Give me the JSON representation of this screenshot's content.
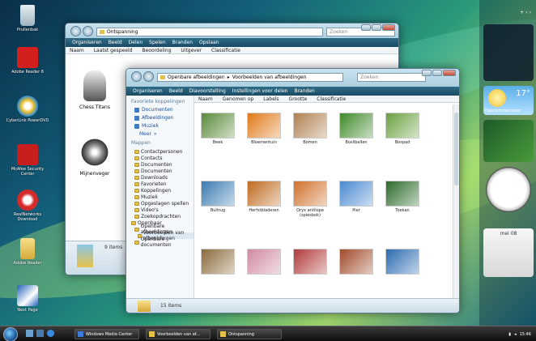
{
  "desktop": {
    "icons": [
      {
        "label": "Prullenbak"
      },
      {
        "label": "Adobe Reader 8"
      },
      {
        "label": "CyberLink PowerDVD"
      },
      {
        "label": "McAfee Security Center"
      },
      {
        "label": "RealNetworks Download"
      },
      {
        "label": "Adobe Reader"
      },
      {
        "label": "Next Page"
      }
    ]
  },
  "back_window": {
    "address": "Ontspanning",
    "search_placeholder": "Zoeken",
    "toolbar": [
      "Organiseren",
      "Beeld",
      "Delen",
      "Spelen",
      "Branden",
      "Opslaan"
    ],
    "columns": [
      "Naam",
      "Laatst gespeeld",
      "Beoordeling",
      "Uitgever",
      "Classificatie"
    ],
    "items": [
      {
        "label": "Chess Titans"
      },
      {
        "label": "Mijnenveger"
      }
    ],
    "status": "9 items"
  },
  "front_window": {
    "breadcrumb": [
      "Openbare afbeeldingen",
      "Voorbeelden van afbeeldingen"
    ],
    "search_placeholder": "Zoeken",
    "toolbar": [
      "Organiseren",
      "Beeld",
      "Diavoorstelling",
      "Instellingen voor delen",
      "Branden"
    ],
    "columns": [
      "Naam",
      "Genomen op",
      "Labels",
      "Grootte",
      "Classificatie"
    ],
    "favorites_header": "Favoriete koppelingen",
    "favorites": [
      "Documenten",
      "Afbeeldingen",
      "Muziek"
    ],
    "more": "Meer",
    "folders_header": "Mappen",
    "tree": [
      "Contactpersonen",
      "Contacts",
      "Documenten",
      "Documenten",
      "Downloads",
      "Favorieten",
      "Koppelingen",
      "Muziek",
      "Opgeslagen spellen",
      "Video's",
      "Zoekopdrachten",
      "Openbaar",
      "Openbare afbeeldingen",
      "Voorbeelden van afbeeldingen",
      "Openbare documenten"
    ],
    "thumbnails": [
      {
        "label": "Beek",
        "color": "#5a8a3a"
      },
      {
        "label": "Bloementuin",
        "color": "#e07a1a"
      },
      {
        "label": "Bomen",
        "color": "#b08050"
      },
      {
        "label": "Boslibellen",
        "color": "#3f8a2a"
      },
      {
        "label": "Bospad",
        "color": "#6aa040"
      },
      {
        "label": "Bultrug",
        "color": "#3a7ab0"
      },
      {
        "label": "Herfstbladeren",
        "color": "#c06a20"
      },
      {
        "label": "Oryx antilope (spiesbok)",
        "color": "#d0702a"
      },
      {
        "label": "Pier",
        "color": "#4a8ad0"
      },
      {
        "label": "Toekan",
        "color": "#2a6a2a"
      },
      {
        "label": "",
        "color": "#8a6a3a"
      },
      {
        "label": "",
        "color": "#d08aa0"
      },
      {
        "label": "",
        "color": "#b03a3a"
      },
      {
        "label": "",
        "color": "#a04a2a"
      },
      {
        "label": "",
        "color": "#2a6ab0"
      }
    ],
    "status": "15 items"
  },
  "sidebar": {
    "weather_temp": "17°",
    "weather_location": "Haarlemmermeer",
    "calendar_month": "mei 08"
  },
  "taskbar": {
    "buttons": [
      "Windows Media Center",
      "Voorbeelden van af...",
      "Ontspanning"
    ],
    "clock": "15:46"
  }
}
